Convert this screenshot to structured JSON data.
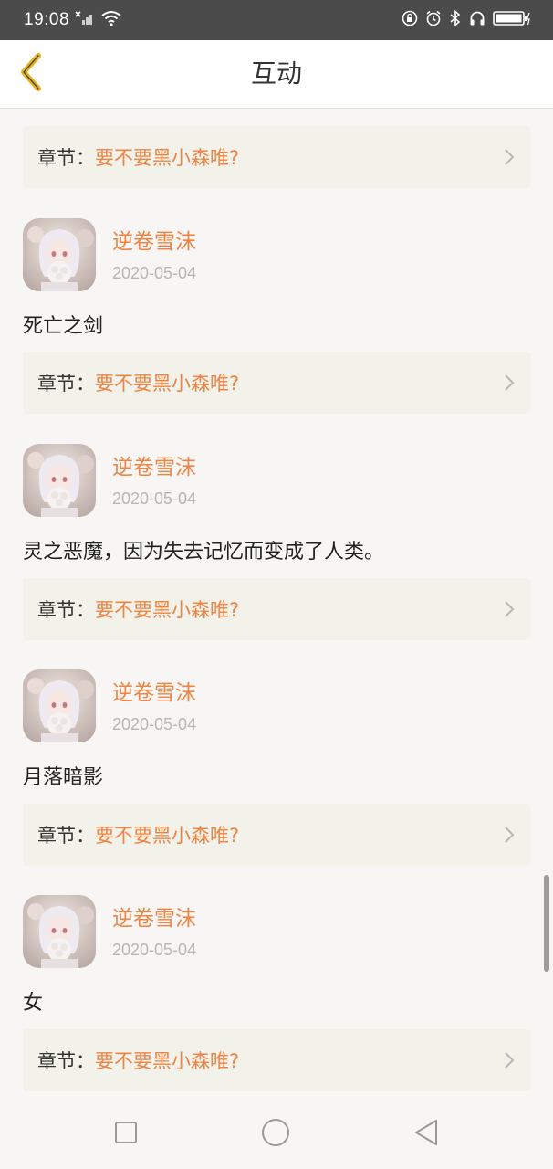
{
  "status_bar": {
    "time": "19:08",
    "icons": [
      "no-signal-icon",
      "wifi-icon",
      "lock-rotation-icon",
      "alarm-icon",
      "bluetooth-icon",
      "headphones-icon",
      "battery-charging-icon"
    ]
  },
  "header": {
    "title": "互动",
    "back_icon": "chevron-left-icon"
  },
  "comments": [
    {
      "username": "逆卷雪沫",
      "date": "2020-05-04",
      "text": "死亡之剑"
    },
    {
      "username": "逆卷雪沫",
      "date": "2020-05-04",
      "text": "灵之恶魔，因为失去记忆而变成了人类。"
    },
    {
      "username": "逆卷雪沫",
      "date": "2020-05-04",
      "text": "月落暗影"
    },
    {
      "username": "逆卷雪沫",
      "date": "2020-05-04",
      "text": "女"
    }
  ],
  "chapter": {
    "prefix": "章节：",
    "title": "要不要黑小森唯?"
  },
  "chapters": [
    {
      "prefix": "章节：",
      "title": "要不要黑小森唯?"
    },
    {
      "prefix": "章节：",
      "title": "要不要黑小森唯?"
    },
    {
      "prefix": "章节：",
      "title": "要不要黑小森唯?"
    },
    {
      "prefix": "章节：",
      "title": "要不要黑小森唯?"
    },
    {
      "prefix": "章节：",
      "title": "要不要黑小森唯?"
    }
  ],
  "colors": {
    "accent": "#ee8443",
    "back_arrow": "#e5b21f",
    "card_bg": "#f2f2ea",
    "status_bar": "#4b4b4b"
  },
  "system_nav": [
    "recent-apps-icon",
    "home-icon",
    "back-triangle-icon"
  ]
}
